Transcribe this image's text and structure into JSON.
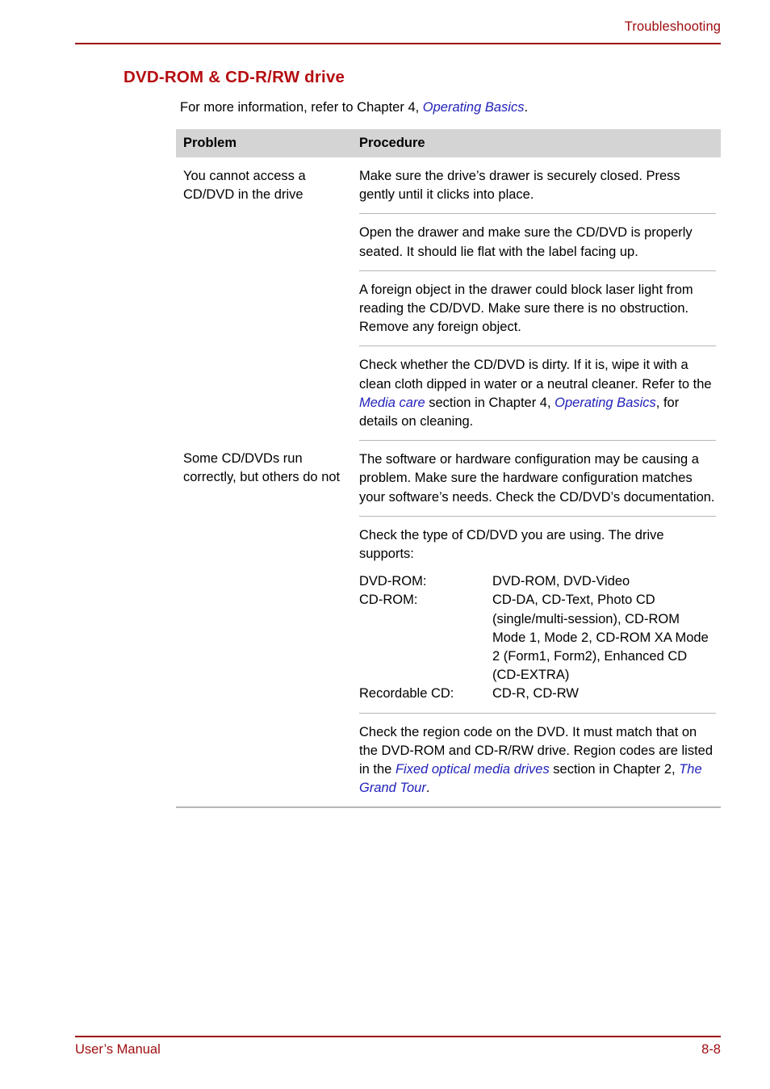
{
  "running_header": {
    "title": "Troubleshooting"
  },
  "section": {
    "heading": "DVD-ROM & CD-R/RW drive",
    "intro_before": "For more information, refer to Chapter 4, ",
    "intro_link": "Operating Basics",
    "intro_after": "."
  },
  "table": {
    "columns": {
      "problem": "Problem",
      "procedure": "Procedure"
    },
    "rows": [
      {
        "problem": "You cannot access a CD/DVD in the drive",
        "procedures": [
          {
            "text": "Make sure the drive’s drawer is securely closed. Press gently until it clicks into place."
          },
          {
            "text": "Open the drawer and make sure the CD/DVD is properly seated. It should lie flat with the label facing up."
          },
          {
            "text": "A foreign object in the drawer could block laser light from reading the CD/DVD. Make sure there is no obstruction. Remove any foreign object."
          },
          {
            "segments": [
              {
                "type": "text",
                "value": "Check whether the CD/DVD is dirty. If it is, wipe it with a clean cloth dipped in water or a neutral cleaner. Refer to the "
              },
              {
                "type": "link",
                "value": "Media care"
              },
              {
                "type": "text",
                "value": " section in Chapter 4, "
              },
              {
                "type": "link",
                "value": "Operating Basics"
              },
              {
                "type": "text",
                "value": ", for details on cleaning."
              }
            ]
          }
        ]
      },
      {
        "problem": "Some CD/DVDs run correctly, but others do not",
        "procedures": [
          {
            "text": "The software or hardware configuration may be causing a problem. Make sure the hardware configuration matches your software’s needs. Check the CD/DVD’s documentation."
          },
          {
            "text": "Check the type of CD/DVD you are using. The drive supports:",
            "spec_list": [
              {
                "label": "DVD-ROM:",
                "value": "DVD-ROM, DVD-Video"
              },
              {
                "label": "CD-ROM:",
                "value": "CD-DA, CD-Text, Photo CD (single/multi-session), CD-ROM Mode 1, Mode 2, CD-ROM XA Mode 2 (Form1, Form2), Enhanced CD (CD-EXTRA)"
              },
              {
                "label": "Recordable CD:",
                "value": "CD-R, CD-RW"
              }
            ]
          },
          {
            "segments": [
              {
                "type": "text",
                "value": "Check the region code on the DVD. It must match that on the DVD-ROM and CD-R/RW drive. Region codes are listed in the "
              },
              {
                "type": "link",
                "value": "Fixed optical media drives"
              },
              {
                "type": "text",
                "value": " section in Chapter 2, "
              },
              {
                "type": "link",
                "value": "The Grand Tour"
              },
              {
                "type": "text",
                "value": "."
              }
            ]
          }
        ]
      }
    ]
  },
  "footer": {
    "left": "User’s Manual",
    "right": "8-8"
  },
  "colors": {
    "accent_red": "#9e0b0f",
    "heading_red": "#b50d11",
    "link_blue": "#2222bb",
    "header_band": "#d4d4d4",
    "rule_gray": "#b6b6b6"
  }
}
